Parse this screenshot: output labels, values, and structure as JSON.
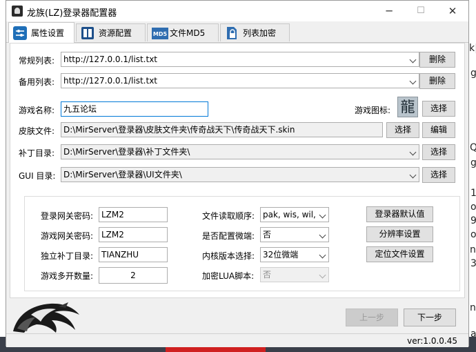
{
  "window": {
    "title": "龙族(LZ)登录器配置器"
  },
  "titlebar_buttons": {
    "minimize": "─",
    "maximize": "☐",
    "close": "✕"
  },
  "tabs": [
    {
      "label": "属性设置",
      "icon": "settings-sliders-icon",
      "active": true
    },
    {
      "label": "资源配置",
      "icon": "resource-grid-icon",
      "active": false
    },
    {
      "label": "文件MD5",
      "icon": "md5-file-icon",
      "active": false
    },
    {
      "label": "列表加密",
      "icon": "lock-file-icon",
      "active": false
    }
  ],
  "form": {
    "regular_list": {
      "label": "常规列表:",
      "value": "http://127.0.0.1/list.txt",
      "button": "删除"
    },
    "backup_list": {
      "label": "备用列表:",
      "value": "http://127.0.0.1/list.txt",
      "button": "删除"
    },
    "game_name": {
      "label": "游戏名称:",
      "value": "九五论坛"
    },
    "game_icon": {
      "label": "游戏图标:",
      "glyph": "龍",
      "button": "选择"
    },
    "skin_file": {
      "label": "皮肤文件:",
      "value": "D:\\MirServer\\登录器\\皮肤文件夹\\传奇战天下\\传奇战天下.skin",
      "select_button": "选择",
      "edit_button": "编辑"
    },
    "patch_dir": {
      "label": "补丁目录:",
      "value": "D:\\MirServer\\登录器\\补丁文件夹\\",
      "button": "选择"
    },
    "gui_dir": {
      "label": "GUI 目录:",
      "value": "D:\\MirServer\\登录器\\UI文件夹\\",
      "button": "选择"
    }
  },
  "options": {
    "login_gateway_pwd": {
      "label": "登录网关密码:",
      "value": "LZM2"
    },
    "game_gateway_pwd": {
      "label": "游戏网关密码:",
      "value": "LZM2"
    },
    "patch_dir_standalone": {
      "label": "独立补丁目录:",
      "value": "TIANZHU"
    },
    "multi_open": {
      "label": "游戏多开数量:",
      "value": "2"
    },
    "file_read_order": {
      "label": "文件读取顺序:",
      "value": "pak, wis, wil,"
    },
    "micro_client": {
      "label": "是否配置微端:",
      "value": "否"
    },
    "kernel_version": {
      "label": "内核版本选择:",
      "value": "32位微端"
    },
    "lua_encrypt": {
      "label": "加密LUA脚本:",
      "value": "否"
    },
    "btn_defaults": "登录器默认值",
    "btn_resolution": "分辨率设置",
    "btn_locate": "定位文件设置"
  },
  "nav": {
    "prev": "上一步",
    "next": "下一步"
  },
  "status": {
    "version": "ver:1.0.0.45"
  },
  "background_fragments": [
    "k|",
    "g",
    "Q",
    "g",
    "1",
    "o",
    "9",
    "o",
    "ni",
    "3",
    "ni",
    "a"
  ]
}
